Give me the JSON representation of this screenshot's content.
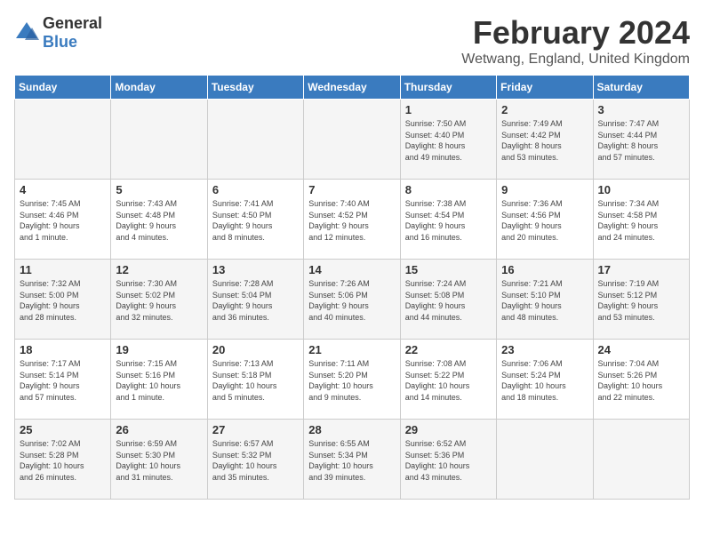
{
  "logo": {
    "general": "General",
    "blue": "Blue"
  },
  "title": "February 2024",
  "location": "Wetwang, England, United Kingdom",
  "days_of_week": [
    "Sunday",
    "Monday",
    "Tuesday",
    "Wednesday",
    "Thursday",
    "Friday",
    "Saturday"
  ],
  "weeks": [
    [
      {
        "day": "",
        "info": ""
      },
      {
        "day": "",
        "info": ""
      },
      {
        "day": "",
        "info": ""
      },
      {
        "day": "",
        "info": ""
      },
      {
        "day": "1",
        "info": "Sunrise: 7:50 AM\nSunset: 4:40 PM\nDaylight: 8 hours\nand 49 minutes."
      },
      {
        "day": "2",
        "info": "Sunrise: 7:49 AM\nSunset: 4:42 PM\nDaylight: 8 hours\nand 53 minutes."
      },
      {
        "day": "3",
        "info": "Sunrise: 7:47 AM\nSunset: 4:44 PM\nDaylight: 8 hours\nand 57 minutes."
      }
    ],
    [
      {
        "day": "4",
        "info": "Sunrise: 7:45 AM\nSunset: 4:46 PM\nDaylight: 9 hours\nand 1 minute."
      },
      {
        "day": "5",
        "info": "Sunrise: 7:43 AM\nSunset: 4:48 PM\nDaylight: 9 hours\nand 4 minutes."
      },
      {
        "day": "6",
        "info": "Sunrise: 7:41 AM\nSunset: 4:50 PM\nDaylight: 9 hours\nand 8 minutes."
      },
      {
        "day": "7",
        "info": "Sunrise: 7:40 AM\nSunset: 4:52 PM\nDaylight: 9 hours\nand 12 minutes."
      },
      {
        "day": "8",
        "info": "Sunrise: 7:38 AM\nSunset: 4:54 PM\nDaylight: 9 hours\nand 16 minutes."
      },
      {
        "day": "9",
        "info": "Sunrise: 7:36 AM\nSunset: 4:56 PM\nDaylight: 9 hours\nand 20 minutes."
      },
      {
        "day": "10",
        "info": "Sunrise: 7:34 AM\nSunset: 4:58 PM\nDaylight: 9 hours\nand 24 minutes."
      }
    ],
    [
      {
        "day": "11",
        "info": "Sunrise: 7:32 AM\nSunset: 5:00 PM\nDaylight: 9 hours\nand 28 minutes."
      },
      {
        "day": "12",
        "info": "Sunrise: 7:30 AM\nSunset: 5:02 PM\nDaylight: 9 hours\nand 32 minutes."
      },
      {
        "day": "13",
        "info": "Sunrise: 7:28 AM\nSunset: 5:04 PM\nDaylight: 9 hours\nand 36 minutes."
      },
      {
        "day": "14",
        "info": "Sunrise: 7:26 AM\nSunset: 5:06 PM\nDaylight: 9 hours\nand 40 minutes."
      },
      {
        "day": "15",
        "info": "Sunrise: 7:24 AM\nSunset: 5:08 PM\nDaylight: 9 hours\nand 44 minutes."
      },
      {
        "day": "16",
        "info": "Sunrise: 7:21 AM\nSunset: 5:10 PM\nDaylight: 9 hours\nand 48 minutes."
      },
      {
        "day": "17",
        "info": "Sunrise: 7:19 AM\nSunset: 5:12 PM\nDaylight: 9 hours\nand 53 minutes."
      }
    ],
    [
      {
        "day": "18",
        "info": "Sunrise: 7:17 AM\nSunset: 5:14 PM\nDaylight: 9 hours\nand 57 minutes."
      },
      {
        "day": "19",
        "info": "Sunrise: 7:15 AM\nSunset: 5:16 PM\nDaylight: 10 hours\nand 1 minute."
      },
      {
        "day": "20",
        "info": "Sunrise: 7:13 AM\nSunset: 5:18 PM\nDaylight: 10 hours\nand 5 minutes."
      },
      {
        "day": "21",
        "info": "Sunrise: 7:11 AM\nSunset: 5:20 PM\nDaylight: 10 hours\nand 9 minutes."
      },
      {
        "day": "22",
        "info": "Sunrise: 7:08 AM\nSunset: 5:22 PM\nDaylight: 10 hours\nand 14 minutes."
      },
      {
        "day": "23",
        "info": "Sunrise: 7:06 AM\nSunset: 5:24 PM\nDaylight: 10 hours\nand 18 minutes."
      },
      {
        "day": "24",
        "info": "Sunrise: 7:04 AM\nSunset: 5:26 PM\nDaylight: 10 hours\nand 22 minutes."
      }
    ],
    [
      {
        "day": "25",
        "info": "Sunrise: 7:02 AM\nSunset: 5:28 PM\nDaylight: 10 hours\nand 26 minutes."
      },
      {
        "day": "26",
        "info": "Sunrise: 6:59 AM\nSunset: 5:30 PM\nDaylight: 10 hours\nand 31 minutes."
      },
      {
        "day": "27",
        "info": "Sunrise: 6:57 AM\nSunset: 5:32 PM\nDaylight: 10 hours\nand 35 minutes."
      },
      {
        "day": "28",
        "info": "Sunrise: 6:55 AM\nSunset: 5:34 PM\nDaylight: 10 hours\nand 39 minutes."
      },
      {
        "day": "29",
        "info": "Sunrise: 6:52 AM\nSunset: 5:36 PM\nDaylight: 10 hours\nand 43 minutes."
      },
      {
        "day": "",
        "info": ""
      },
      {
        "day": "",
        "info": ""
      }
    ]
  ]
}
